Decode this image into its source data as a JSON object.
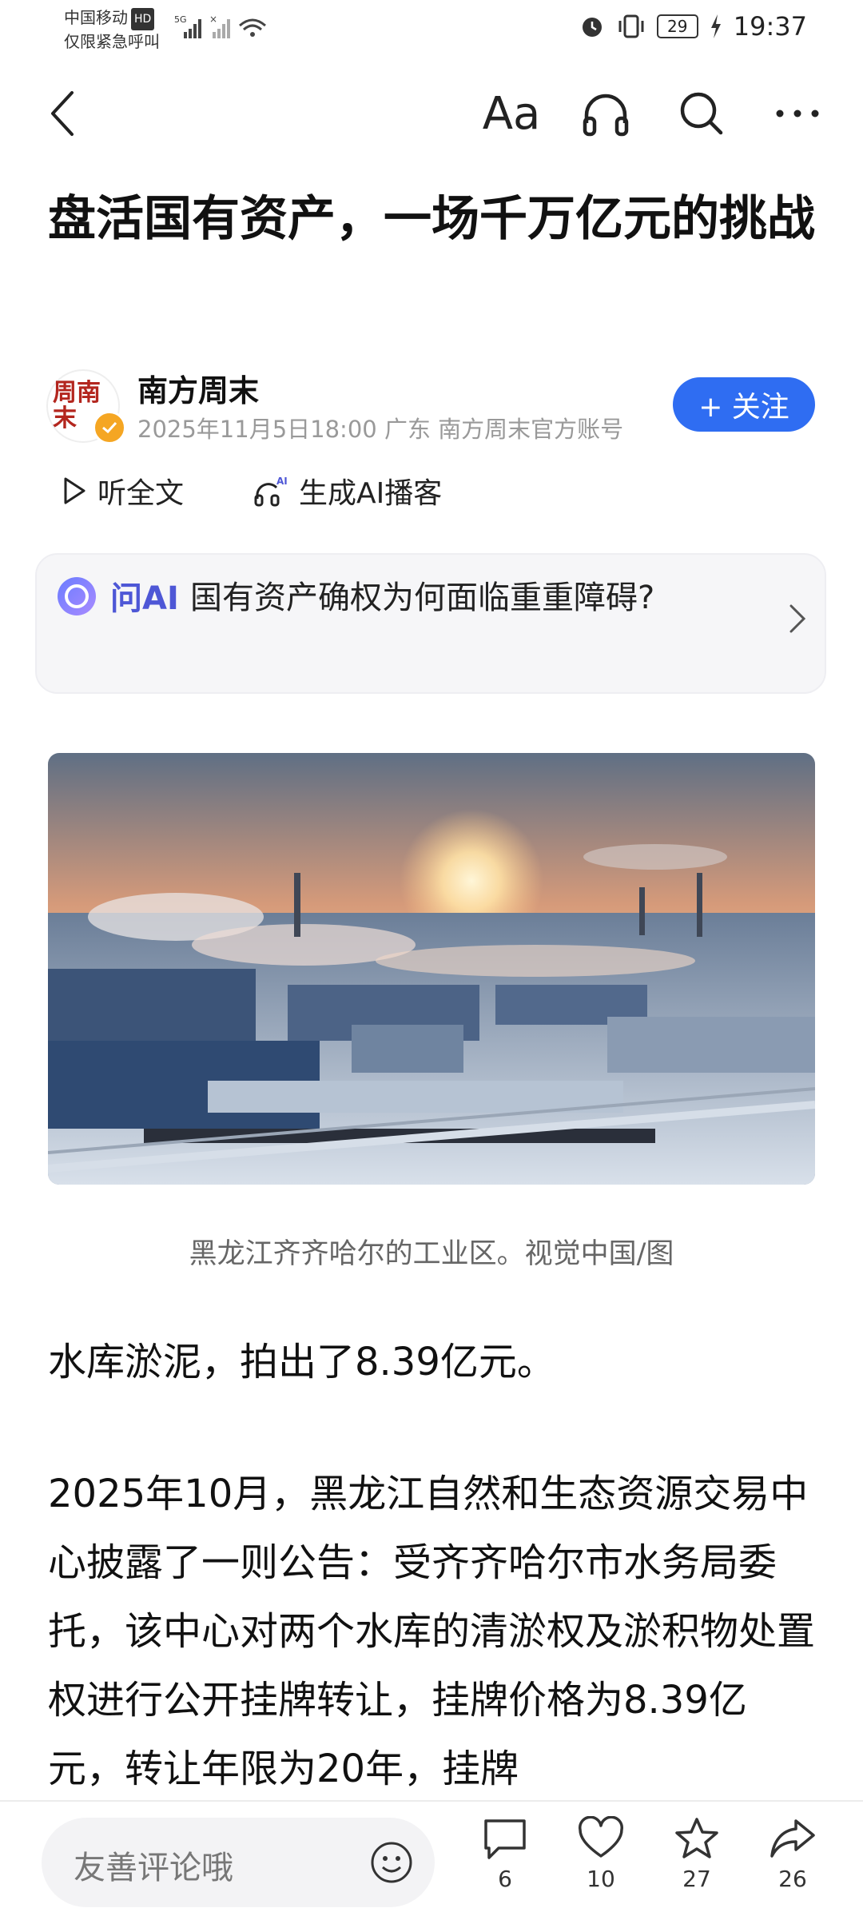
{
  "status_bar": {
    "carrier": "中国移动",
    "carrier_badge": "HD",
    "emergency": "仅限紧急呼叫",
    "network": "5G",
    "battery": "29",
    "time": "19:37"
  },
  "nav": {
    "font_label": "Aa",
    "icons": [
      "back-icon",
      "font-size-icon",
      "headphones-icon",
      "search-icon",
      "more-icon"
    ]
  },
  "article": {
    "title": "盘活国有资产，一场千万亿元的挑战",
    "author": {
      "name": "南方周末",
      "avatar_text": "周南末",
      "meta": "2025年11月5日18:00 广东 南方周末官方账号"
    },
    "follow_label": "+ 关注",
    "listen_label": "听全文",
    "podcast_label": "生成AI播客",
    "podcast_badge": "AI",
    "ask_ai": {
      "label": "问AI",
      "separator": "·",
      "question": "国有资产确权为何面临重重障碍?"
    },
    "image_caption": "黑龙江齐齐哈尔的工业区。视觉中国/图",
    "paragraphs": [
      "水库淤泥，拍出了8.39亿元。",
      "2025年10月，黑龙江自然和生态资源交易中心披露了一则公告：受齐齐哈尔市水务局委托，该中心对两个水库的清淤权及淤积物处置权进行公开挂牌转让，挂牌价格为8.39亿元，转让年限为20年，挂牌"
    ]
  },
  "bottom_bar": {
    "comment_placeholder": "友善评论哦",
    "comments": "6",
    "likes": "10",
    "favorites": "27",
    "shares": "26"
  },
  "colors": {
    "accent_blue": "#2f6df2",
    "ai_purple": "#4e57d6",
    "verify_gold": "#f5a623",
    "seal_red": "#b3261e"
  }
}
